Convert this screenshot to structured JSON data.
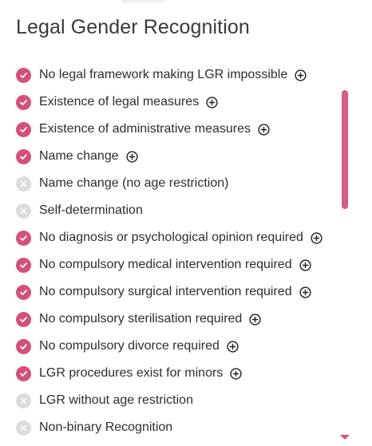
{
  "title": "Legal Gender Recognition",
  "colors": {
    "accent": "#d64f7c",
    "inactive": "#dcdcdc",
    "scrollbar": "#d85b86"
  },
  "items": [
    {
      "label": "No legal framework making LGR impossible",
      "status": "check",
      "expandable": true
    },
    {
      "label": "Existence of legal measures",
      "status": "check",
      "expandable": true
    },
    {
      "label": "Existence of administrative measures",
      "status": "check",
      "expandable": true
    },
    {
      "label": "Name change",
      "status": "check",
      "expandable": true
    },
    {
      "label": "Name change (no age restriction)",
      "status": "cross",
      "expandable": false
    },
    {
      "label": "Self-determination",
      "status": "cross",
      "expandable": false
    },
    {
      "label": "No diagnosis or psychological opinion required",
      "status": "check",
      "expandable": true
    },
    {
      "label": "No compulsory medical intervention required",
      "status": "check",
      "expandable": true
    },
    {
      "label": "No compulsory surgical intervention required",
      "status": "check",
      "expandable": true
    },
    {
      "label": "No compulsory sterilisation required",
      "status": "check",
      "expandable": true
    },
    {
      "label": "No compulsory divorce required",
      "status": "check",
      "expandable": true
    },
    {
      "label": "LGR procedures exist for minors",
      "status": "check",
      "expandable": true
    },
    {
      "label": "LGR without age restriction",
      "status": "cross",
      "expandable": false
    },
    {
      "label": "Non-binary Recognition",
      "status": "cross",
      "expandable": false
    }
  ],
  "icons": {
    "check": "check-circle-icon",
    "cross": "cross-circle-icon",
    "expand": "plus-circle-icon"
  }
}
